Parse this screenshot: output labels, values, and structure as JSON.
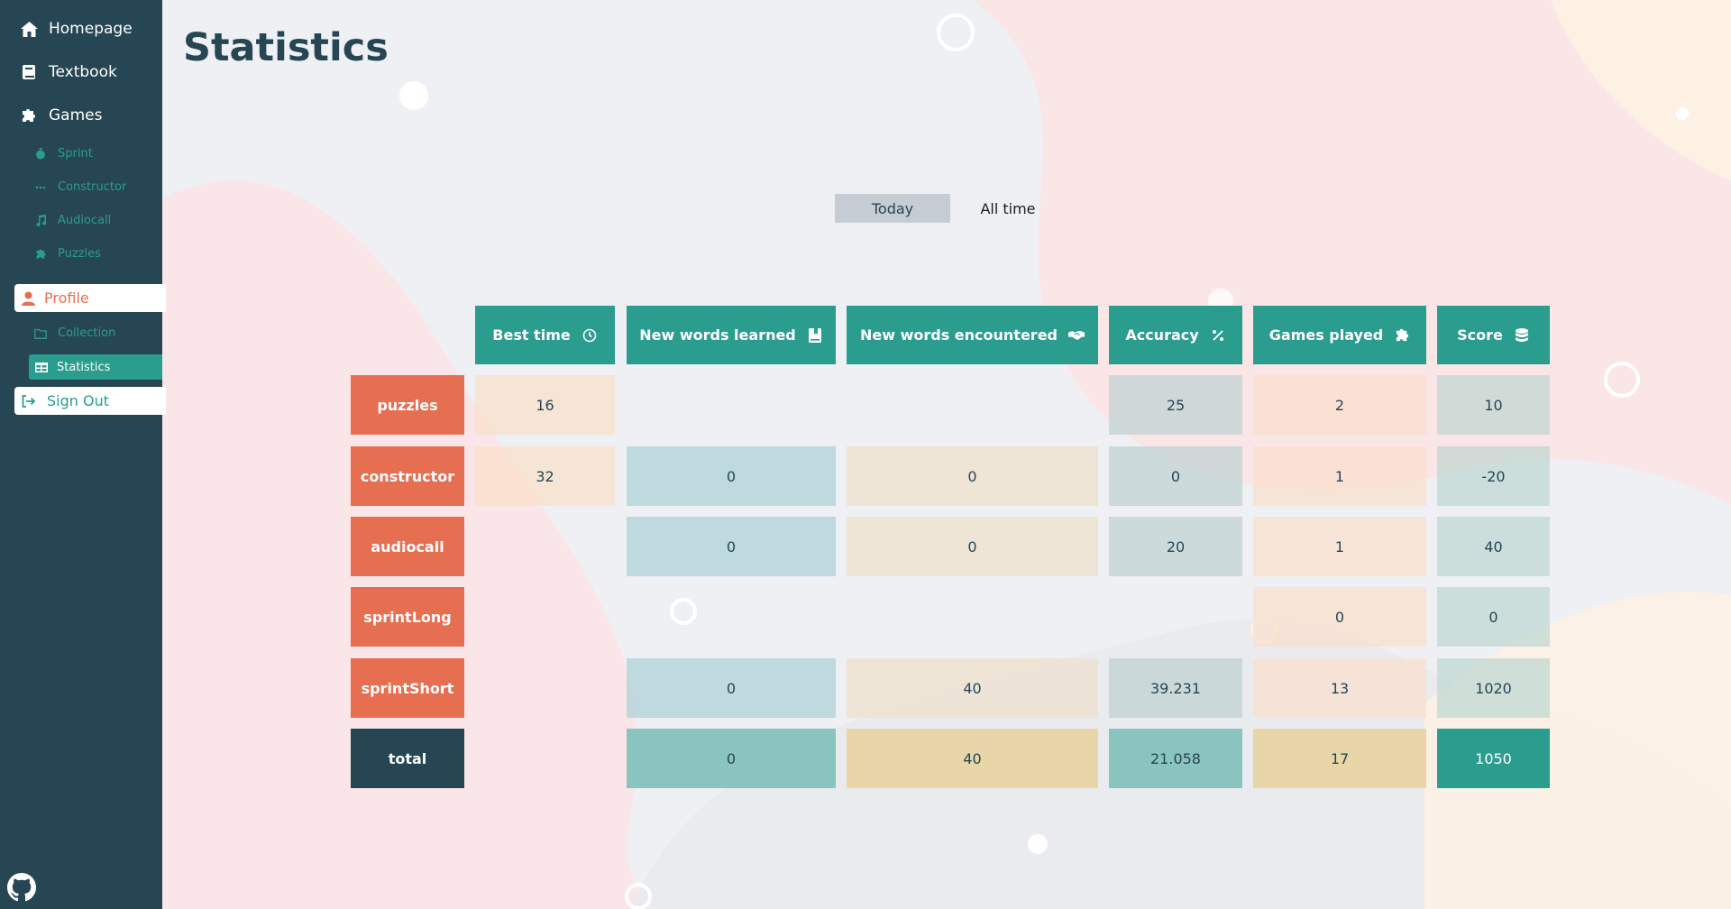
{
  "nav": {
    "homepage": "Homepage",
    "textbook": "Textbook",
    "games": "Games",
    "sprint": "Sprint",
    "constructor": "Constructor",
    "audiocall": "Audiocall",
    "puzzles": "Puzzles",
    "profile": "Profile",
    "collection": "Collection",
    "statistics": "Statistics",
    "signout": "Sign Out"
  },
  "page": {
    "title": "Statistics"
  },
  "tabs": {
    "today": "Today",
    "alltime": "All time",
    "selected": "Today"
  },
  "colors": {
    "sidebar": "#264653",
    "accent": "#2a9d8f",
    "orange": "#e76f51",
    "label": "#264653"
  },
  "table": {
    "headers": {
      "best_time": "Best time",
      "new_words_learned": "New words learned",
      "new_words_encountered": "New words encountered",
      "accuracy": "Accuracy",
      "games_played": "Games played",
      "score": "Score"
    },
    "rows": [
      {
        "name": "puzzles",
        "best_time": "16",
        "learned": "",
        "encountered": "",
        "accuracy": "25",
        "games": "2",
        "score": "10"
      },
      {
        "name": "constructor",
        "best_time": "32",
        "learned": "0",
        "encountered": "0",
        "accuracy": "0",
        "games": "1",
        "score": "-20"
      },
      {
        "name": "audiocall",
        "best_time": "",
        "learned": "0",
        "encountered": "0",
        "accuracy": "20",
        "games": "1",
        "score": "40"
      },
      {
        "name": "sprintLong",
        "best_time": "",
        "learned": "",
        "encountered": "",
        "accuracy": "",
        "games": "0",
        "score": "0"
      },
      {
        "name": "sprintShort",
        "best_time": "",
        "learned": "0",
        "encountered": "40",
        "accuracy": "39.231",
        "games": "13",
        "score": "1020"
      },
      {
        "name": "total",
        "best_time": "",
        "learned": "0",
        "encountered": "40",
        "accuracy": "21.058",
        "games": "17",
        "score": "1050"
      }
    ]
  }
}
